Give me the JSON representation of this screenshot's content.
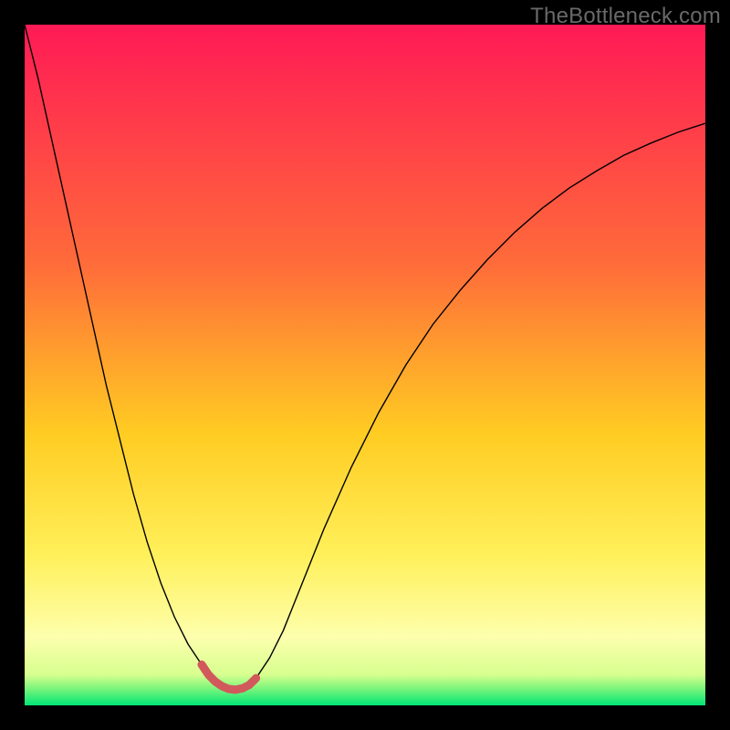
{
  "watermark": "TheBottleneck.com",
  "chart_data": {
    "type": "line",
    "title": "",
    "xlabel": "",
    "ylabel": "",
    "xlim": [
      0,
      100
    ],
    "ylim": [
      0,
      100
    ],
    "background_gradient_stops": [
      {
        "pos": 0.0,
        "color": "#ff1a55"
      },
      {
        "pos": 0.35,
        "color": "#ff6b3a"
      },
      {
        "pos": 0.6,
        "color": "#ffcc22"
      },
      {
        "pos": 0.78,
        "color": "#fff05a"
      },
      {
        "pos": 0.9,
        "color": "#fdffad"
      },
      {
        "pos": 0.955,
        "color": "#d7ff8f"
      },
      {
        "pos": 0.975,
        "color": "#7cf57c"
      },
      {
        "pos": 1.0,
        "color": "#00e676"
      }
    ],
    "series": [
      {
        "name": "bottleneck-curve",
        "color": "#000000",
        "stroke_width": 1.4,
        "x": [
          0,
          2,
          4,
          6,
          8,
          10,
          12,
          14,
          16,
          18,
          20,
          22,
          24,
          26,
          27,
          28,
          29,
          30,
          31,
          32,
          33,
          34,
          36,
          38,
          40,
          44,
          48,
          52,
          56,
          60,
          64,
          68,
          72,
          76,
          80,
          84,
          88,
          92,
          96,
          100
        ],
        "y": [
          100,
          92,
          83,
          74,
          65,
          56,
          47,
          39,
          31,
          24,
          18,
          13,
          9,
          6,
          4.5,
          3.5,
          2.8,
          2.4,
          2.3,
          2.5,
          3.0,
          4.0,
          7,
          11,
          16,
          26,
          35,
          43,
          50,
          56,
          61,
          65.5,
          69.5,
          73,
          76,
          78.5,
          80.8,
          82.6,
          84.2,
          85.5
        ]
      },
      {
        "name": "bottom-marker",
        "color": "#d1595c",
        "stroke_width": 9,
        "linecap": "round",
        "x": [
          26,
          27,
          28,
          29,
          30,
          31,
          32,
          33,
          34
        ],
        "y": [
          6,
          4.5,
          3.5,
          2.8,
          2.4,
          2.3,
          2.5,
          3.0,
          4.0
        ]
      }
    ]
  }
}
